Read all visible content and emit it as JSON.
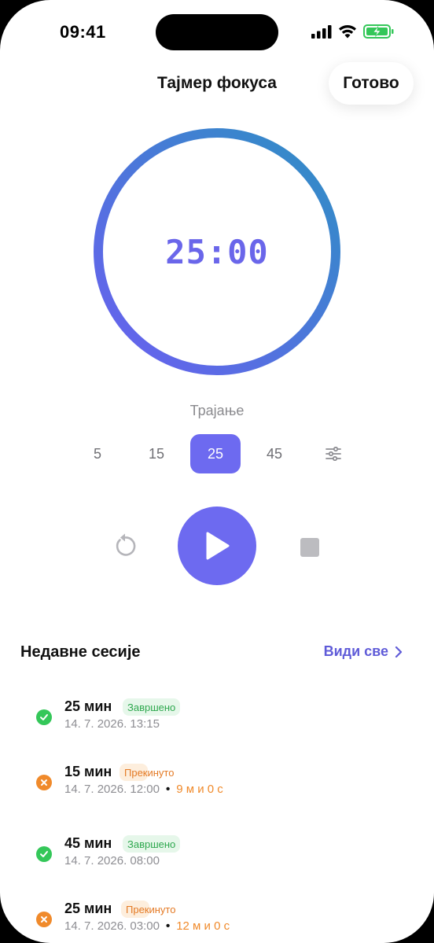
{
  "status_bar": {
    "time": "09:41"
  },
  "nav": {
    "title": "Тајмер фокуса",
    "done_label": "Готово"
  },
  "timer": {
    "display": "25:00",
    "progress": 1.0
  },
  "duration": {
    "label": "Трајање",
    "options": [
      "5",
      "15",
      "25",
      "45"
    ],
    "selected": "25"
  },
  "recent": {
    "title": "Недавне сесије",
    "see_all": "Види све",
    "sessions": [
      {
        "duration": "25 мин",
        "status": "Завршено",
        "state": "done",
        "date": "14. 7. 2026. 13:15",
        "elapsed": ""
      },
      {
        "duration": "15 мин",
        "status": "Прекинуто",
        "state": "stopped",
        "date": "14. 7. 2026. 12:00",
        "elapsed": "9 м и 0 с"
      },
      {
        "duration": "45 мин",
        "status": "Завршено",
        "state": "done",
        "date": "14. 7. 2026. 08:00",
        "elapsed": ""
      },
      {
        "duration": "25 мин",
        "status": "Прекинуто",
        "state": "stopped",
        "date": "14. 7. 2026. 03:00",
        "elapsed": "12 м и 0 с"
      }
    ]
  },
  "colors": {
    "accent": "#6d6af0",
    "ring_start": "#2e8fc4",
    "ring_end": "#6a5ff0",
    "done": "#34c759",
    "stopped": "#f08a2b"
  },
  "icons": [
    "signal-icon",
    "wifi-icon",
    "battery-charging-icon",
    "sliders-icon",
    "reset-icon",
    "play-icon",
    "stop-icon",
    "chevron-right-icon",
    "check-icon",
    "x-icon"
  ]
}
